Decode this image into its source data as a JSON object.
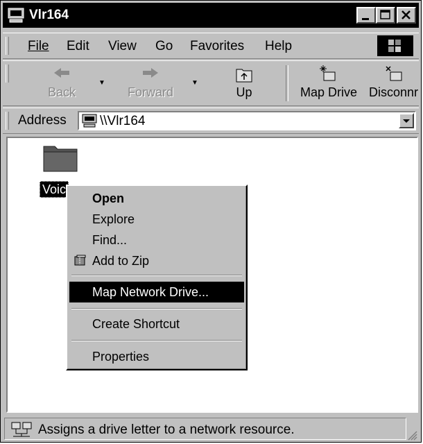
{
  "window": {
    "title": "Vlr164"
  },
  "menubar": {
    "items": [
      "File",
      "Edit",
      "View",
      "Go",
      "Favorites",
      "Help"
    ]
  },
  "toolbar": {
    "back": "Back",
    "forward": "Forward",
    "up": "Up",
    "map_drive": "Map Drive",
    "disconnect": "Disconnr"
  },
  "address": {
    "label": "Address",
    "value": "\\\\Vlr164"
  },
  "content": {
    "folder_label": "Voic"
  },
  "context_menu": {
    "open": "Open",
    "explore": "Explore",
    "find": "Find...",
    "add_to_zip": "Add to Zip",
    "map_network_drive": "Map Network Drive...",
    "create_shortcut": "Create Shortcut",
    "properties": "Properties"
  },
  "status": {
    "text": "Assigns a drive letter to a network resource."
  },
  "icons": [
    "computer-icon",
    "minimize-icon",
    "maximize-icon",
    "close-icon",
    "windows-flag-icon",
    "back-arrow-icon",
    "forward-arrow-icon",
    "up-folder-icon",
    "map-drive-icon",
    "disconnect-icon",
    "folder-icon",
    "zip-icon",
    "network-icon"
  ]
}
